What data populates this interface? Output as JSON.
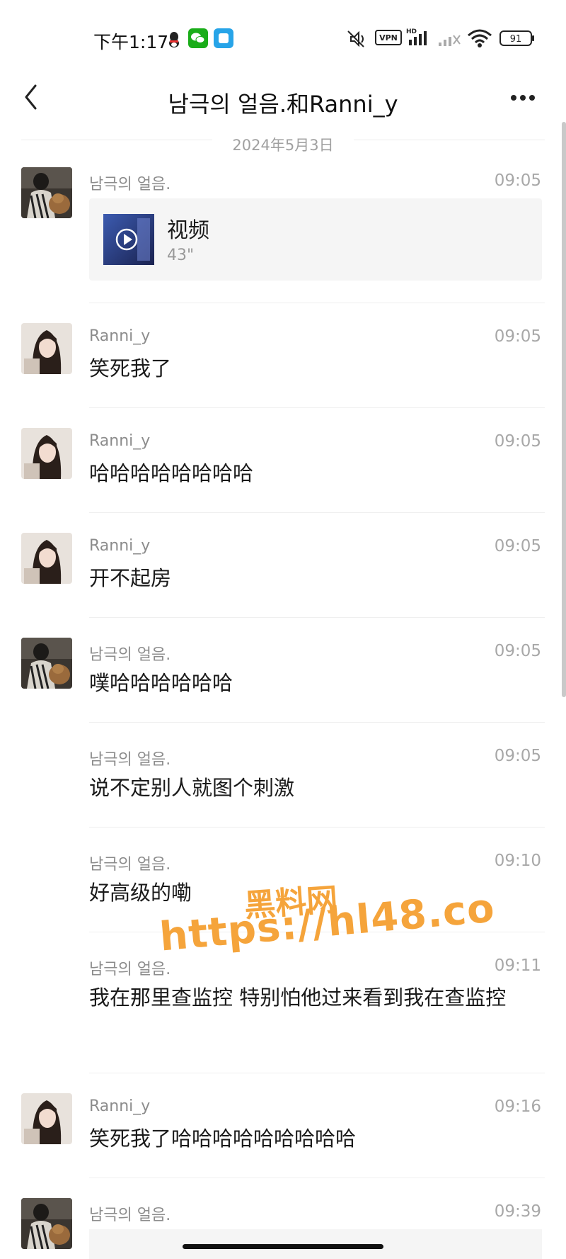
{
  "status_bar": {
    "time": "下午1:17",
    "battery": "91",
    "vpn_label": "VPN",
    "hd_label": "HD"
  },
  "header": {
    "title": "남극의 얼음.和Ranni_y"
  },
  "date_separator": "2024年5月3日",
  "messages": [
    {
      "sender": "남극의 얼음.",
      "time": "09:05",
      "video_title": "视频",
      "video_duration": "43\""
    },
    {
      "sender": "Ranni_y",
      "time": "09:05",
      "text": "笑死我了"
    },
    {
      "sender": "Ranni_y",
      "time": "09:05",
      "text": "哈哈哈哈哈哈哈哈"
    },
    {
      "sender": "Ranni_y",
      "time": "09:05",
      "text": "开不起房"
    },
    {
      "sender": "남극의 얼음.",
      "time": "09:05",
      "text": "噗哈哈哈哈哈哈"
    },
    {
      "sender": "남극의 얼음.",
      "time": "09:05",
      "text": "说不定别人就图个刺激"
    },
    {
      "sender": "남극의 얼음.",
      "time": "09:10",
      "text": "好高级的嘞"
    },
    {
      "sender": "남극의 얼음.",
      "time": "09:11",
      "text": "我在那里查监控 特别怕他过来看到我在查监控"
    },
    {
      "sender": "Ranni_y",
      "time": "09:16",
      "text": "笑死我了哈哈哈哈哈哈哈哈哈"
    },
    {
      "sender": "남극의 얼음.",
      "time": "09:39"
    }
  ],
  "watermark": {
    "line1": "黑料网",
    "line2": "https://hl48.co"
  },
  "colors": {
    "background": "#ffffff",
    "meta_text": "#a8a8a8",
    "watermark": "#f5a43b"
  }
}
